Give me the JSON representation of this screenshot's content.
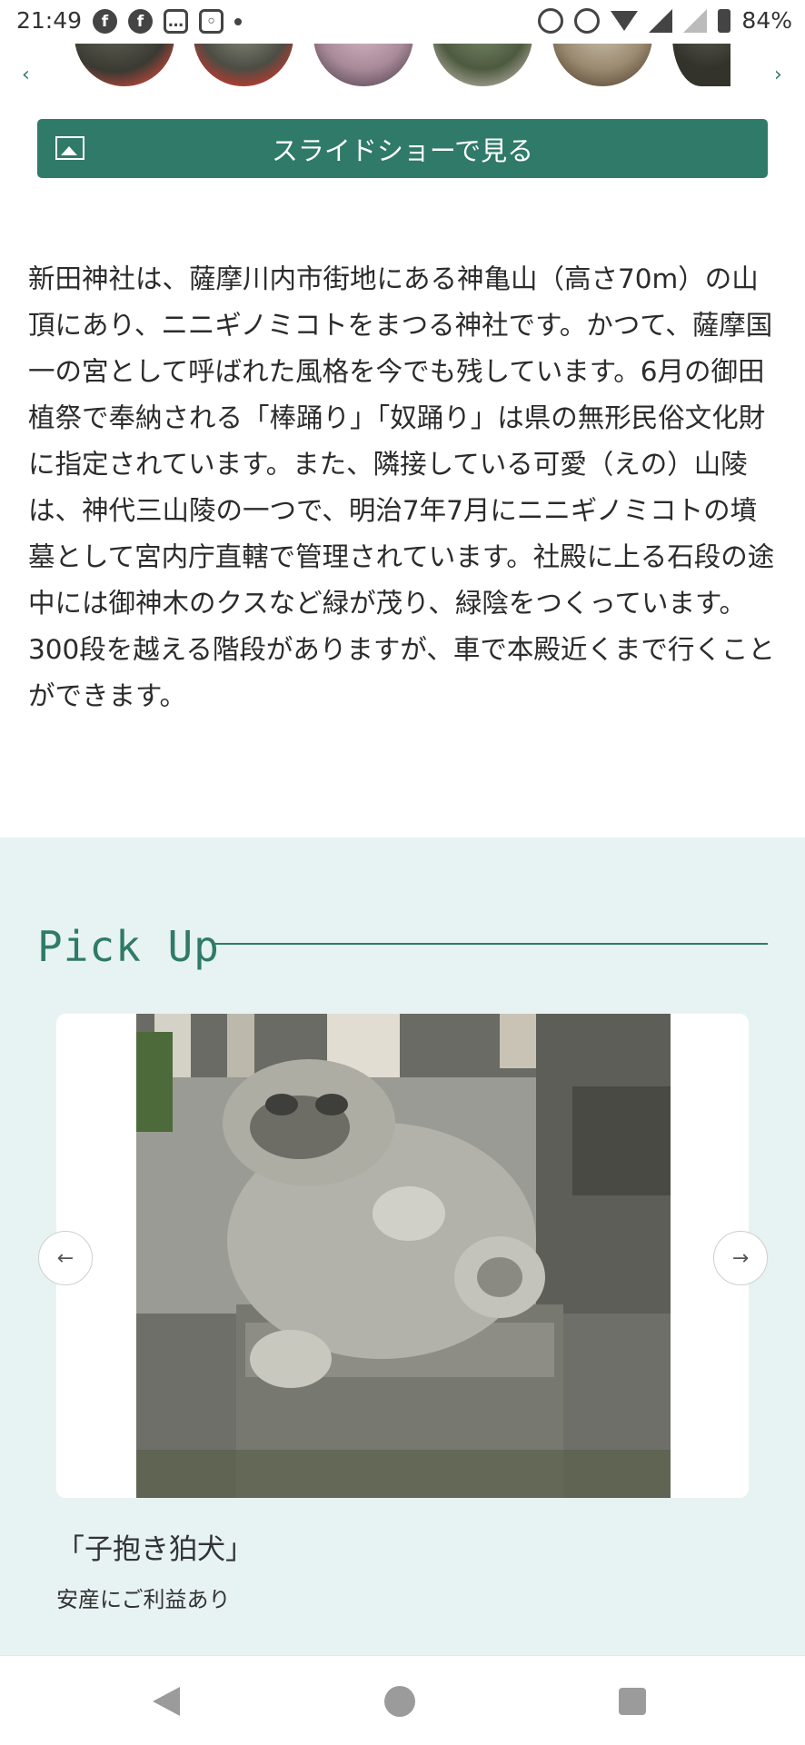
{
  "status_bar": {
    "time": "21:49",
    "battery": "84%",
    "icons": [
      "facebook-icon",
      "facebook-icon",
      "chat-icon",
      "instagram-icon",
      "dot-icon",
      "alarm-icon",
      "sync-icon",
      "wifi-icon",
      "signal-icon",
      "signal-icon",
      "battery-icon"
    ]
  },
  "gallery": {
    "arrow_left": "‹",
    "arrow_right": "›"
  },
  "slideshow": {
    "label": "スライドショーで見る"
  },
  "description": {
    "text": "新田神社は、薩摩川内市街地にある神亀山（高さ70m）の山頂にあり、ニニギノミコトをまつる神社です。かつて、薩摩国一の宮として呼ばれた風格を今でも残しています。6月の御田植祭で奉納される「棒踊り」「奴踊り」は県の無形民俗文化財に指定されています。また、隣接している可愛（えの）山陵は、神代三山陵の一つで、明治7年7月にニニギノミコトの墳墓として宮内庁直轄で管理されています。社殿に上る石段の途中には御神木のクスなど緑が茂り、緑陰をつくっています。300段を越える階段がありますが、車で本殿近くまで行くことができます。"
  },
  "pickup": {
    "title": "Pick Up",
    "prev_label": "←",
    "next_label": "→",
    "caption_title": "「子抱き狛犬」",
    "caption_sub": "安産にご利益あり"
  },
  "colors": {
    "accent": "#2f7a68",
    "section_bg": "#e6f3f2"
  }
}
